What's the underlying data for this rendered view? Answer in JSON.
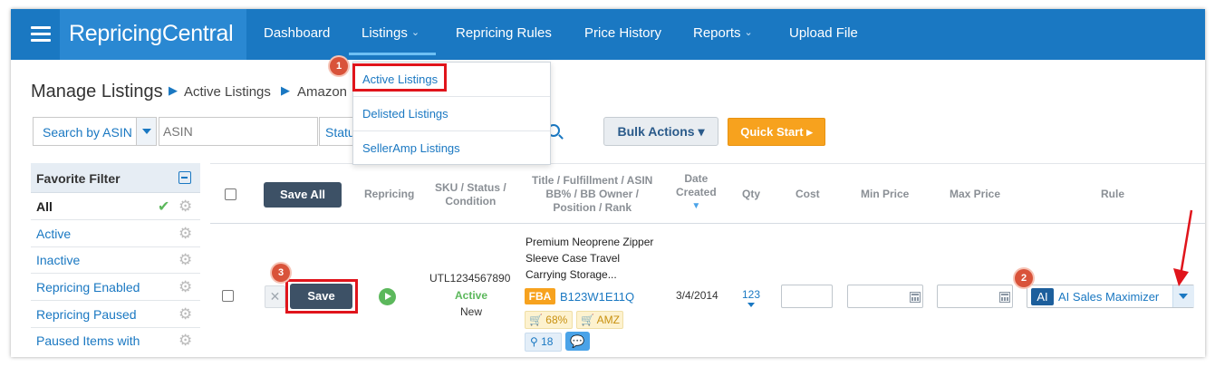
{
  "nav": {
    "brand_a": "Repricing",
    "brand_b": "Central",
    "items": [
      {
        "label": "Dashboard"
      },
      {
        "label": "Listings",
        "caret": "⌄"
      },
      {
        "label": "Repricing Rules"
      },
      {
        "label": "Price History"
      },
      {
        "label": "Reports",
        "caret": "⌄"
      },
      {
        "label": "Upload File"
      }
    ]
  },
  "breadcrumb": {
    "title": "Manage Listings",
    "items": [
      "Active Listings",
      "Amazon"
    ]
  },
  "listings_menu": {
    "items": [
      "Active Listings",
      "Delisted Listings",
      "SellerAmp Listings"
    ]
  },
  "annotations": {
    "badge1": "1",
    "badge2": "2",
    "badge3": "3"
  },
  "filters": {
    "search_by": "Search by ASIN",
    "asin_placeholder": "ASIN",
    "status_label": "Status",
    "bulk_actions": "Bulk Actions ▾",
    "quick_start": "Quick Start ▸"
  },
  "sidebar": {
    "header": "Favorite Filter",
    "items": [
      {
        "label": "All"
      },
      {
        "label": "Active"
      },
      {
        "label": "Inactive"
      },
      {
        "label": "Repricing Enabled"
      },
      {
        "label": "Repricing Paused"
      },
      {
        "label": "Paused Items with"
      }
    ]
  },
  "table": {
    "save_all": "Save All",
    "headers": {
      "repricing": "Repricing",
      "sku_1": "SKU / Status /",
      "sku_2": "Condition",
      "title_1": "Title / Fulfillment / ASIN",
      "title_2": "BB% / BB Owner /",
      "title_3": "Position / Rank",
      "date_1": "Date",
      "date_2": "Created",
      "qty": "Qty",
      "cost": "Cost",
      "min_price": "Min Price",
      "max_price": "Max Price",
      "rule": "Rule"
    },
    "row": {
      "cancel": "✕",
      "save": "Save",
      "sku": "UTL1234567890",
      "status": "Active",
      "condition": "New",
      "title_1": "Premium Neoprene Zipper",
      "title_2": "Sleeve Case Travel",
      "title_3": "Carrying Storage...",
      "fulfillment": "FBA",
      "asin": "B123W1E11Q",
      "bb_pct": "🛒 68%",
      "bb_owner": "🛒 AMZ",
      "position": "⚲ 18",
      "date": "3/4/2014",
      "qty": "123",
      "rule_tag": "AI",
      "rule": "AI Sales Maximizer"
    }
  },
  "colors": {
    "nav": "#1a78c2",
    "accent_orange": "#f7a21e",
    "highlight_red": "#e0141b",
    "active_green": "#5cb85c"
  }
}
